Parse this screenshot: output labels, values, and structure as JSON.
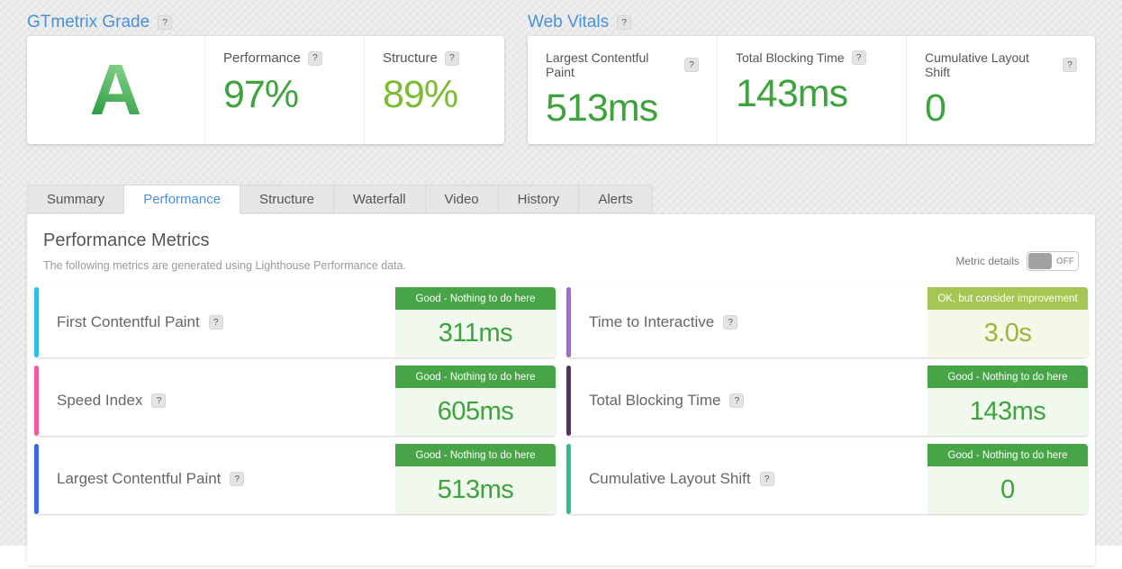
{
  "icons": {
    "help": "?"
  },
  "colors": {
    "brand_blue": "#4a90d9",
    "value_green": "#3da33d",
    "structure_green": "#7bbd2e",
    "good_badge_bg": "#47a447",
    "good_value_bg": "#f1f8ee",
    "good_value_text": "#3da33d",
    "ok_badge_bg": "#a4c652",
    "ok_value_bg": "#f5f8e6",
    "ok_value_text": "#9fb43a"
  },
  "grade_section": {
    "title": "GTmetrix Grade",
    "grade": "A",
    "metrics": [
      {
        "label": "Performance",
        "value": "97%"
      },
      {
        "label": "Structure",
        "value": "89%"
      }
    ]
  },
  "vitals_section": {
    "title": "Web Vitals",
    "metrics": [
      {
        "label": "Largest Contentful Paint",
        "value": "513ms"
      },
      {
        "label": "Total Blocking Time",
        "value": "143ms"
      },
      {
        "label": "Cumulative Layout Shift",
        "value": "0"
      }
    ]
  },
  "tabs": [
    {
      "label": "Summary"
    },
    {
      "label": "Performance"
    },
    {
      "label": "Structure"
    },
    {
      "label": "Waterfall"
    },
    {
      "label": "Video"
    },
    {
      "label": "History"
    },
    {
      "label": "Alerts"
    }
  ],
  "active_tab": "Performance",
  "panel": {
    "title": "Performance Metrics",
    "subtitle": "The following metrics are generated using Lighthouse Performance data.",
    "toggle_label": "Metric details",
    "toggle_state": "OFF"
  },
  "metric_cards": [
    {
      "label": "First Contentful Paint",
      "badge": "Good - Nothing to do here",
      "value": "311ms",
      "accent": "#2fbcee",
      "status": "good"
    },
    {
      "label": "Time to Interactive",
      "badge": "OK, but consider improvement",
      "value": "3.0s",
      "accent": "#a569d2",
      "status": "ok"
    },
    {
      "label": "Speed Index",
      "badge": "Good - Nothing to do here",
      "value": "605ms",
      "accent": "#f25c9f",
      "status": "good"
    },
    {
      "label": "Total Blocking Time",
      "badge": "Good - Nothing to do here",
      "value": "143ms",
      "accent": "#533266",
      "status": "good"
    },
    {
      "label": "Largest Contentful Paint",
      "badge": "Good - Nothing to do here",
      "value": "513ms",
      "accent": "#3e66e0",
      "status": "good"
    },
    {
      "label": "Cumulative Layout Shift",
      "badge": "Good - Nothing to do here",
      "value": "0",
      "accent": "#2fbd8a",
      "status": "good"
    }
  ]
}
